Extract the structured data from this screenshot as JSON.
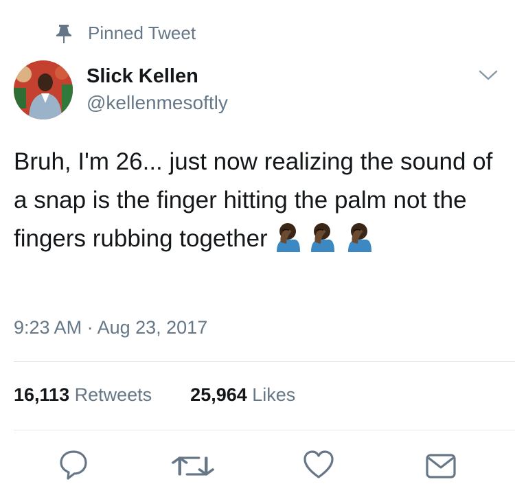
{
  "pinned": {
    "label": "Pinned Tweet",
    "icon": "pin-icon"
  },
  "author": {
    "name": "Slick Kellen",
    "handle": "@kellenmesoftly"
  },
  "tweet": {
    "text": "Bruh, I'm 26... just now realizing the sound of a snap is the finger hitting the palm not the fingers rubbing together",
    "emoji": "facepalm-icon",
    "emoji_count": 3
  },
  "meta": {
    "timestamp": "9:23 AM · Aug 23, 2017"
  },
  "stats": {
    "retweets_count": "16,113",
    "retweets_label": "Retweets",
    "likes_count": "25,964",
    "likes_label": "Likes"
  },
  "actions": [
    "reply-icon",
    "retweet-icon",
    "like-icon",
    "message-icon"
  ],
  "colors": {
    "text": "#14171a",
    "secondary": "#657786",
    "divider": "#e1e8ed"
  }
}
